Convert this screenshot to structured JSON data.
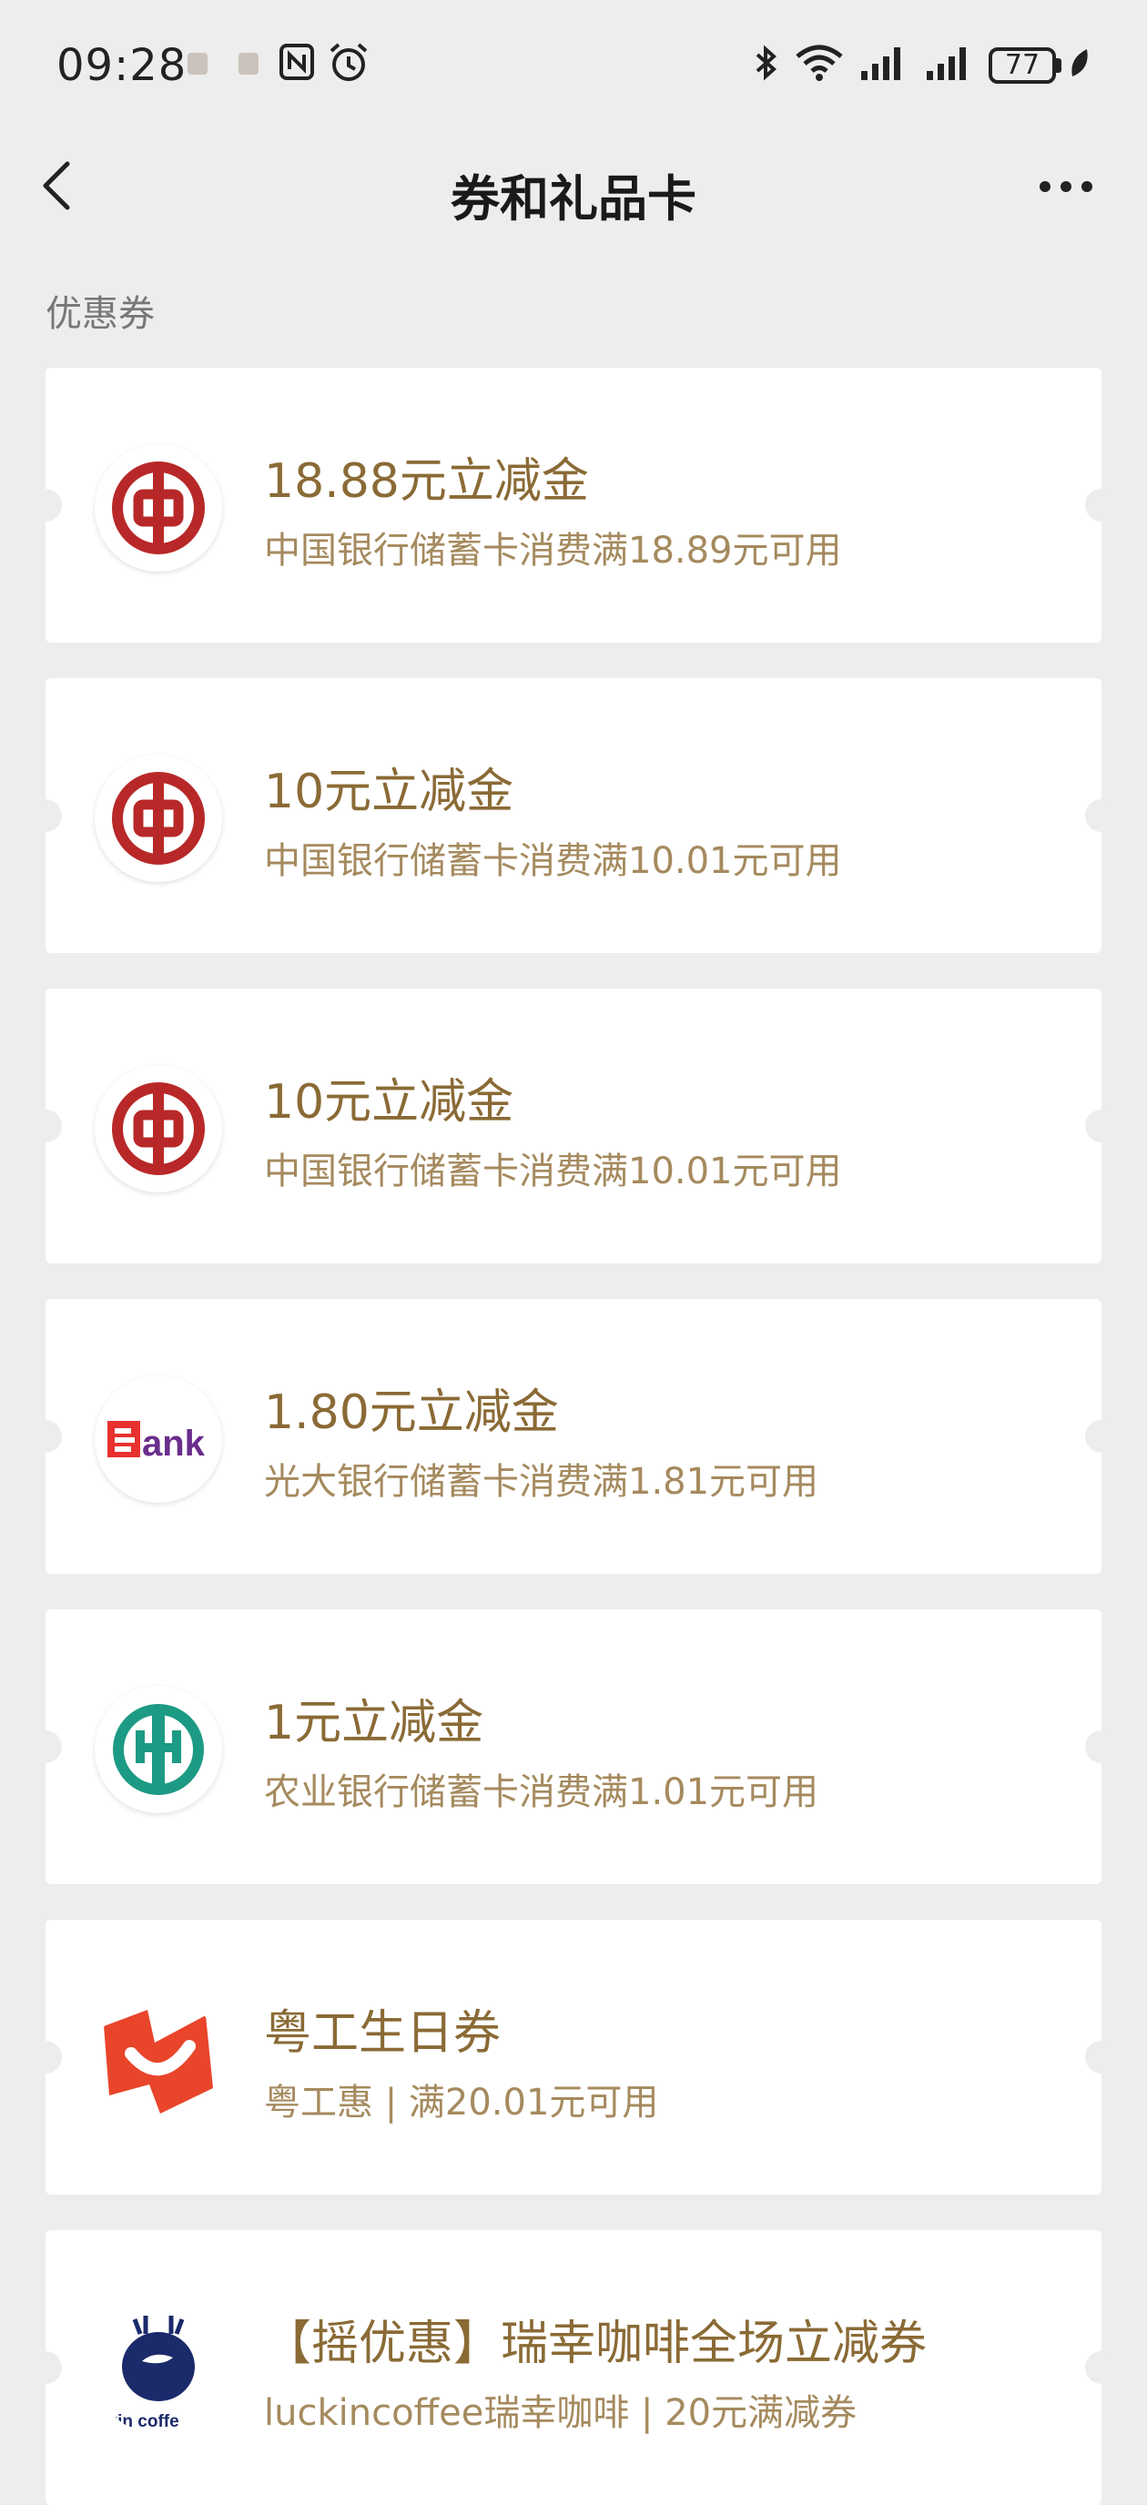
{
  "status": {
    "time": "09:28",
    "battery": "77"
  },
  "nav": {
    "title": "券和礼品卡"
  },
  "section": {
    "label": "优惠券"
  },
  "coupons": [
    {
      "title": "18.88元立减金",
      "subtitle": "中国银行储蓄卡消费满18.89元可用",
      "logo": "boc-logo"
    },
    {
      "title": "10元立减金",
      "subtitle": "中国银行储蓄卡消费满10.01元可用",
      "logo": "boc-logo"
    },
    {
      "title": "10元立减金",
      "subtitle": "中国银行储蓄卡消费满10.01元可用",
      "logo": "boc-logo"
    },
    {
      "title": "1.80元立减金",
      "subtitle": "光大银行储蓄卡消费满1.81元可用",
      "logo": "ebank-logo",
      "logo_text": "Bank"
    },
    {
      "title": "1元立减金",
      "subtitle": "农业银行储蓄卡消费满1.01元可用",
      "logo": "abc-logo"
    },
    {
      "title": "粤工生日券",
      "subtitle": "粤工惠 | 满20.01元可用",
      "logo": "yuegonghui-logo"
    },
    {
      "title": "【摇优惠】瑞幸咖啡全场立减券",
      "subtitle": "luckincoffee瑞幸咖啡 | 20元满减券",
      "logo": "luckin-logo",
      "logo_text": "luckin coffee"
    }
  ],
  "colors": {
    "background": "#ededed",
    "title_gold": "#8a6a35",
    "subtitle_gold": "#a58a5e",
    "boc_red": "#b82828",
    "abc_green": "#1d9a84"
  }
}
